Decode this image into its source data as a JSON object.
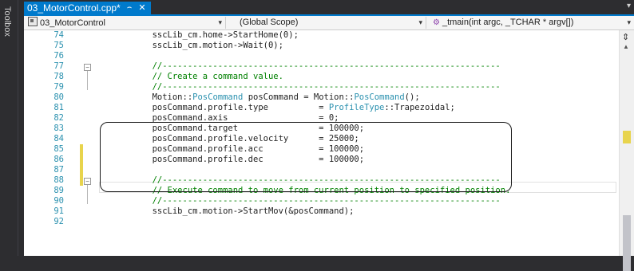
{
  "toolbox": {
    "label": "Toolbox"
  },
  "tab": {
    "title": "03_MotorControl.cpp*",
    "pin": "⌢",
    "close": "✕"
  },
  "navbar": {
    "project": "03_MotorControl",
    "scope": "(Global Scope)",
    "function": "_tmain(int argc, _TCHAR * argv[])"
  },
  "lines": [
    {
      "num": "74",
      "text": "        sscLib_cm.home->StartHome(0);"
    },
    {
      "num": "75",
      "text": "        sscLib_cm.motion->Wait(0);"
    },
    {
      "num": "76",
      "text": ""
    },
    {
      "num": "77",
      "text": "        //-------------------------------------------------------------------"
    },
    {
      "num": "78",
      "text": "        // Create a command value."
    },
    {
      "num": "79",
      "text": "        //-------------------------------------------------------------------"
    },
    {
      "num": "80",
      "text": "        Motion::PosCommand posCommand = Motion::PosCommand();"
    },
    {
      "num": "81",
      "text": "        posCommand.profile.type          = ProfileType::Trapezoidal;"
    },
    {
      "num": "82",
      "text": "        posCommand.axis                  = 0;"
    },
    {
      "num": "83",
      "text": "        posCommand.target                = 100000;"
    },
    {
      "num": "84",
      "text": "        posCommand.profile.velocity      = 25000;"
    },
    {
      "num": "85",
      "text": "        posCommand.profile.acc           = 100000;"
    },
    {
      "num": "86",
      "text": "        posCommand.profile.dec           = 100000;"
    },
    {
      "num": "87",
      "text": ""
    },
    {
      "num": "88",
      "text": "        //-------------------------------------------------------------------"
    },
    {
      "num": "89",
      "text": "        // Execute command to move from current position to specified position."
    },
    {
      "num": "90",
      "text": "        //-------------------------------------------------------------------"
    },
    {
      "num": "91",
      "text": "        sscLib_cm.motion->StartMov(&posCommand);"
    },
    {
      "num": "92",
      "text": ""
    }
  ],
  "colors": {
    "accent": "#007acc",
    "comment": "#008000",
    "type": "#2b91af",
    "change_marker": "#e8d44d"
  }
}
